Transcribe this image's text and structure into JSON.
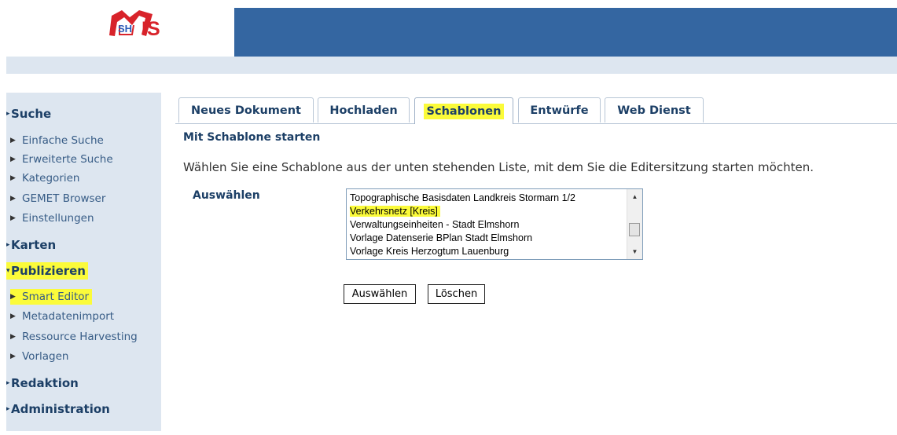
{
  "header": {
    "logo_text": "SH MIS",
    "colors": {
      "bar": "#3466a1",
      "logo_red": "#d8232a",
      "subbar": "#dde6f0"
    }
  },
  "sidebar": {
    "sections": [
      {
        "label": "Suche",
        "expanded": false,
        "items": [
          "Einfache Suche",
          "Erweiterte Suche",
          "Kategorien",
          "GEMET Browser",
          "Einstellungen"
        ]
      },
      {
        "label": "Karten",
        "expanded": false,
        "items": []
      },
      {
        "label": "Publizieren",
        "expanded": true,
        "highlighted": true,
        "items": [
          "Smart Editor",
          "Metadatenimport",
          "Ressource Harvesting",
          "Vorlagen"
        ],
        "highlighted_item": "Smart Editor"
      },
      {
        "label": "Redaktion",
        "expanded": false,
        "items": []
      },
      {
        "label": "Administration",
        "expanded": false,
        "items": []
      }
    ],
    "icons": {
      "collapsed": "triangle-right-icon",
      "expanded": "triangle-down-icon",
      "item": "triangle-right-icon"
    }
  },
  "tabs": [
    {
      "label": "Neues Dokument",
      "active": false
    },
    {
      "label": "Hochladen",
      "active": false
    },
    {
      "label": "Schablonen",
      "active": true
    },
    {
      "label": "Entwürfe",
      "active": false
    },
    {
      "label": "Web Dienst",
      "active": false
    }
  ],
  "main": {
    "heading": "Mit Schablone starten",
    "intro": "Wählen Sie eine Schablone aus der unten stehenden Liste, mit dem Sie die Editersitzung starten möchten.",
    "select_label": "Auswählen",
    "templates": [
      "Topographische Basisdaten Landkreis Stormarn 1/2",
      "Verkehrsnetz [Kreis]",
      "Verwaltungseinheiten - Stadt Elmshorn",
      "Vorlage Datenserie BPlan Stadt Elmshorn",
      "Vorlage Kreis Herzogtum Lauenburg"
    ],
    "highlighted_template": "Verkehrsnetz [Kreis]",
    "buttons": {
      "select": "Auswählen",
      "clear": "Löschen"
    }
  },
  "highlight_color": "#fbfb3a"
}
